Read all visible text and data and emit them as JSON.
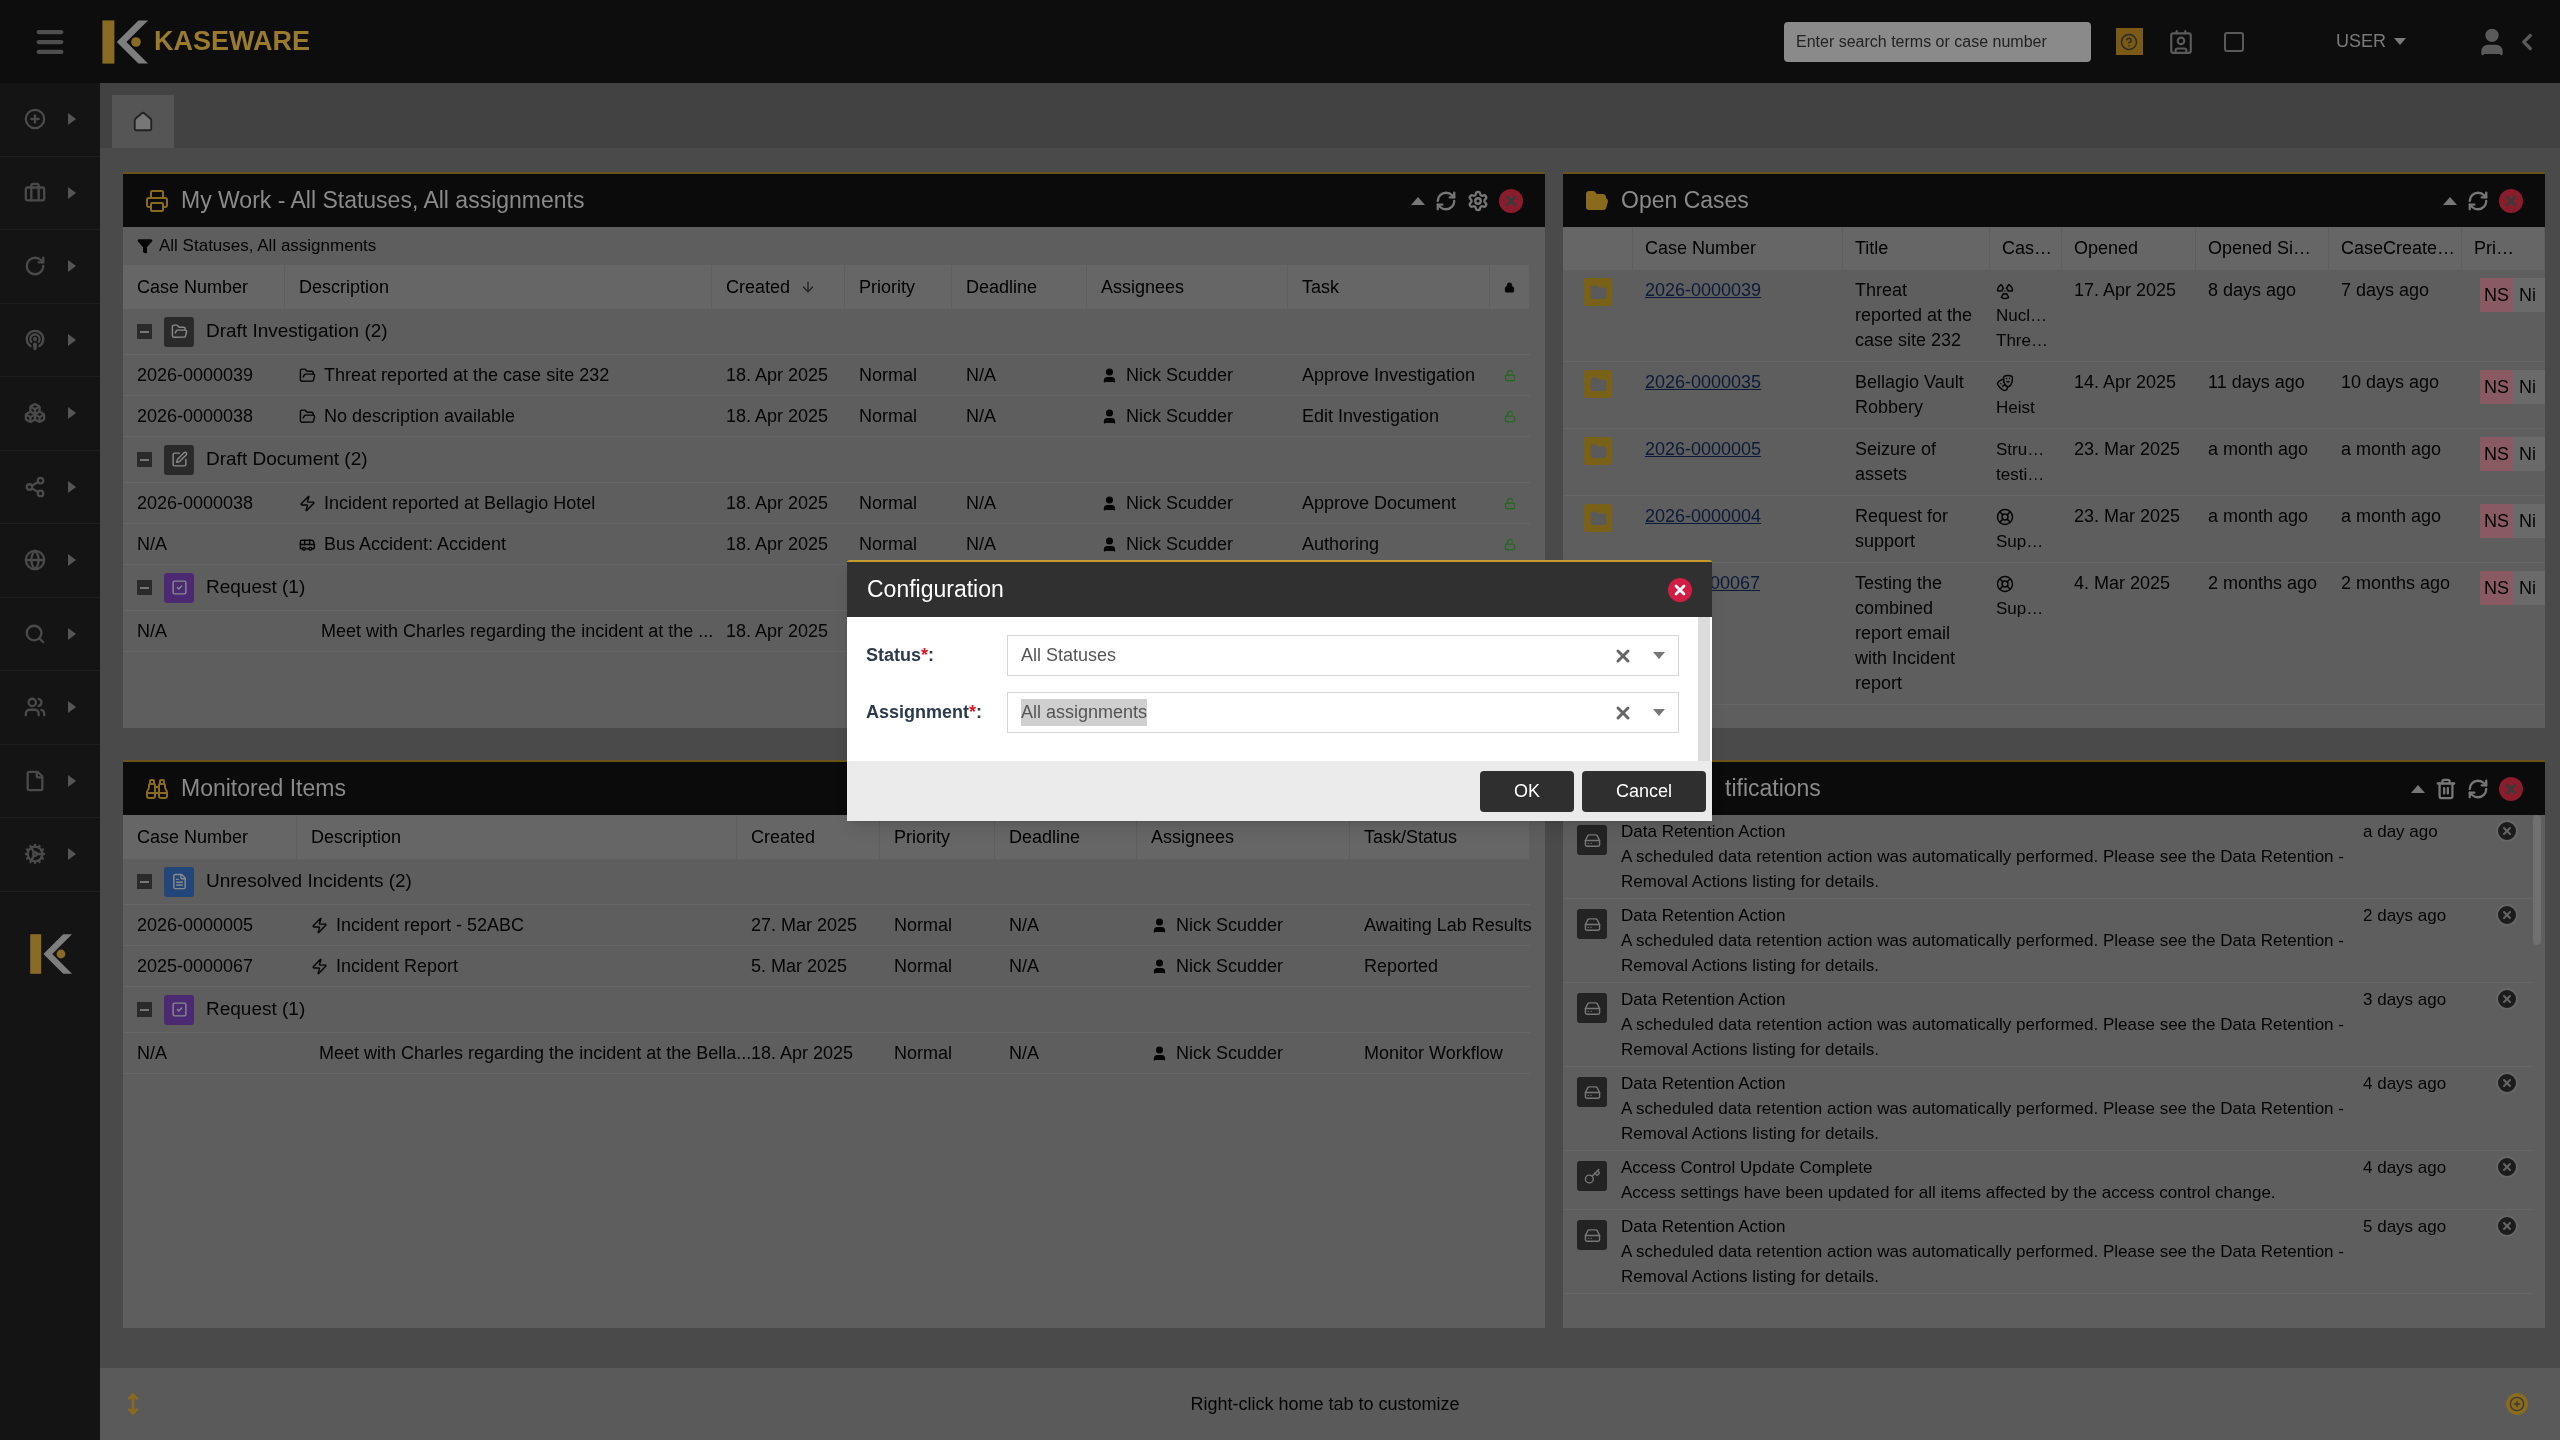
{
  "topbar": {
    "brand": "KASEWARE",
    "search": {
      "placeholder": "Enter search terms or case number"
    },
    "user_menu": "USER"
  },
  "my_work": {
    "title": "My Work - All Statuses, All assignments",
    "filter": "All Statuses, All assignments",
    "columns": [
      {
        "kind": "text",
        "label": "Case Number",
        "sorted": false
      },
      {
        "kind": "text",
        "label": "Description",
        "sorted": false
      },
      {
        "kind": "text",
        "label": "Created",
        "sorted": true
      },
      {
        "kind": "text",
        "label": "Priority",
        "sorted": false
      },
      {
        "kind": "text",
        "label": "Deadline",
        "sorted": false
      },
      {
        "kind": "text",
        "label": "Assignees",
        "sorted": false
      },
      {
        "kind": "text",
        "label": "Task",
        "sorted": false
      },
      {
        "kind": "lock",
        "sorted": false
      }
    ],
    "groups": [
      {
        "label": "Draft Investigation (2)",
        "kind": "folder",
        "color": "#2a2a2a",
        "expanded": true,
        "rows": [
          {
            "case": "2026-0000039",
            "kind": "folder",
            "description": "Threat reported at the case site 232",
            "created": "18. Apr 2025",
            "priority": "Normal",
            "deadline": "N/A",
            "assignee": "Nick Scudder",
            "task": "Approve Investigation",
            "locked": false
          },
          {
            "case": "2026-0000038",
            "kind": "folder",
            "description": "No description available",
            "created": "18. Apr 2025",
            "priority": "Normal",
            "deadline": "N/A",
            "assignee": "Nick Scudder",
            "task": "Edit Investigation",
            "locked": false
          }
        ]
      },
      {
        "label": "Draft Document (2)",
        "kind": "edit",
        "color": "#2a2a2a",
        "expanded": true,
        "rows": [
          {
            "case": "2026-0000038",
            "kind": "bolt",
            "description": "Incident reported at Bellagio Hotel",
            "created": "18. Apr 2025",
            "priority": "Normal",
            "deadline": "N/A",
            "assignee": "Nick Scudder",
            "task": "Approve Document",
            "locked": false
          },
          {
            "case": "N/A",
            "kind": "bus",
            "description": "Bus Accident: Accident",
            "created": "18. Apr 2025",
            "priority": "Normal",
            "deadline": "N/A",
            "assignee": "Nick Scudder",
            "task": "Authoring",
            "locked": false
          }
        ]
      },
      {
        "label": "Request (1)",
        "kind": "check",
        "color": "#4b2a73",
        "expanded": true,
        "rows": [
          {
            "case": "N/A",
            "kind": "plain",
            "description": "Meet with Charles regarding the incident at the ...",
            "created": "18. Apr 2025"
          }
        ]
      }
    ]
  },
  "open_cases": {
    "title": "Open Cases",
    "columns": [
      "Case Number",
      "Title",
      "Cas…",
      "Opened",
      "Opened Si…",
      "CaseCreate…",
      "Pri…"
    ],
    "rows": [
      {
        "case": "2026-0000039",
        "title": "Threat reported at the case site 232",
        "kind": "radiation",
        "types": [
          "Nucl…",
          "Thre…"
        ],
        "opened": "17. Apr 2025",
        "since": "8 days ago",
        "created": "7 days ago",
        "badge": "NS",
        "priority": "Ni"
      },
      {
        "case": "2026-0000035",
        "title": "Bellagio Vault Robbery",
        "kind": "mask",
        "types": [
          "Heist"
        ],
        "opened": "14. Apr 2025",
        "since": "11 days ago",
        "created": "10 days ago",
        "badge": "NS",
        "priority": "Ni"
      },
      {
        "case": "2026-0000005",
        "title": "Seizure of assets",
        "kind": "plain",
        "types": [
          "Stru…",
          "testi…"
        ],
        "opened": "23. Mar 2025",
        "since": "a month ago",
        "created": "a month ago",
        "badge": "NS",
        "priority": "Ni"
      },
      {
        "case": "2026-0000004",
        "title": "Request for support",
        "kind": "support",
        "types": [
          "Sup…"
        ],
        "opened": "23. Mar 2025",
        "since": "a month ago",
        "created": "a month ago",
        "badge": "NS",
        "priority": "Ni"
      },
      {
        "case": "00067",
        "title": "Testing the combined report email with Incident report",
        "kind": "support",
        "types": [
          "Sup…"
        ],
        "opened": "4. Mar 2025",
        "since": "2 months ago",
        "created": "2 months ago",
        "badge": "NS",
        "priority": "Ni"
      }
    ]
  },
  "monitored": {
    "title": "Monitored Items",
    "columns": [
      "Case Number",
      "Description",
      "Created",
      "Priority",
      "Deadline",
      "Assignees",
      "Task/Status"
    ],
    "groups": [
      {
        "label": "Unresolved Incidents (2)",
        "kind": "file",
        "color": "#23467a",
        "expanded": true,
        "rows": [
          {
            "case": "2026-0000005",
            "kind": "bolt",
            "description": "Incident report - 52ABC",
            "created": "27. Mar 2025",
            "priority": "Normal",
            "deadline": "N/A",
            "assignee": "Nick Scudder",
            "task": "Awaiting Lab Results"
          },
          {
            "case": "2025-0000067",
            "kind": "bolt",
            "description": "Incident Report",
            "created": "5. Mar 2025",
            "priority": "Normal",
            "deadline": "N/A",
            "assignee": "Nick Scudder",
            "task": "Reported"
          }
        ]
      },
      {
        "label": "Request (1)",
        "kind": "check",
        "color": "#4b2a73",
        "expanded": true,
        "rows": [
          {
            "case": "N/A",
            "kind": "check",
            "description": "Meet with Charles regarding the incident at the Bella...",
            "created": "18. Apr 2025",
            "priority": "Normal",
            "deadline": "N/A",
            "assignee": "Nick Scudder",
            "task": "Monitor Workflow"
          }
        ]
      }
    ]
  },
  "notifications": {
    "title": "tifications",
    "items": [
      {
        "kind": "retention",
        "title": "Data Retention Action",
        "body": "A scheduled data retention action was automatically performed. Please see the Data Retention - Removal Actions listing for details.",
        "time": "a day ago"
      },
      {
        "kind": "retention",
        "title": "Data Retention Action",
        "body": "A scheduled data retention action was automatically performed. Please see the Data Retention - Removal Actions listing for details.",
        "time": "2 days ago"
      },
      {
        "kind": "retention",
        "title": "Data Retention Action",
        "body": "A scheduled data retention action was automatically performed. Please see the Data Retention - Removal Actions listing for details.",
        "time": "3 days ago"
      },
      {
        "kind": "retention",
        "title": "Data Retention Action",
        "body": "A scheduled data retention action was automatically performed. Please see the Data Retention - Removal Actions listing for details.",
        "time": "4 days ago"
      },
      {
        "kind": "access",
        "title": "Access Control Update Complete",
        "body": "Access settings have been updated for all items affected by the access control change.",
        "time": "4 days ago"
      },
      {
        "kind": "retention",
        "title": "Data Retention Action",
        "body": "A scheduled data retention action was automatically performed. Please see the Data Retention - Removal Actions listing for details.",
        "time": "5 days ago"
      }
    ]
  },
  "footer": {
    "hint": "Right-click home tab to customize"
  },
  "dialog": {
    "title": "Configuration",
    "fields": [
      {
        "label": "Status",
        "required_mark": "*",
        "label_end": ":",
        "value": "All Statuses",
        "highlighted": false
      },
      {
        "label": "Assignment",
        "required_mark": "*",
        "label_end": ":",
        "value": "All assignments",
        "highlighted": true
      }
    ],
    "buttons": [
      "OK",
      "Cancel"
    ]
  }
}
